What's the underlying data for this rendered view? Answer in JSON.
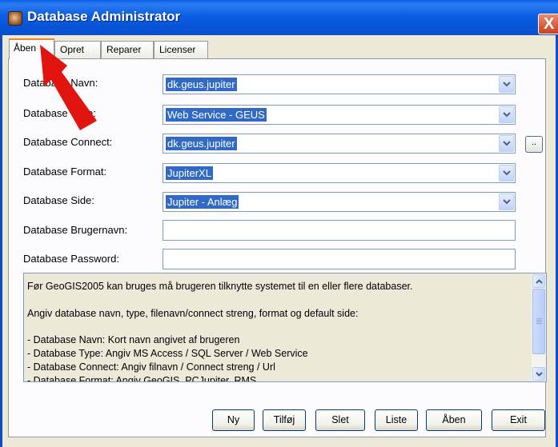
{
  "window": {
    "title": "Database Administrator",
    "close_label": "X"
  },
  "tabs": [
    {
      "label": "Åben"
    },
    {
      "label": "Opret"
    },
    {
      "label": "Reparer"
    },
    {
      "label": "Licenser"
    }
  ],
  "fields": {
    "name": {
      "label": "Database Navn:",
      "value": "dk.geus.jupiter"
    },
    "type": {
      "label": "Database Type:",
      "value": "Web Service - GEUS"
    },
    "connect": {
      "label": "Database Connect:",
      "value": "dk.geus.jupiter",
      "browse_label": ".."
    },
    "format": {
      "label": "Database Format:",
      "value": "JupiterXL"
    },
    "side": {
      "label": "Database Side:",
      "value": "Jupiter - Anlæg"
    },
    "username": {
      "label": "Database Brugernavn:",
      "value": ""
    },
    "password": {
      "label": "Database Password:",
      "value": ""
    }
  },
  "info": {
    "lines": [
      "Før GeoGIS2005 kan bruges må brugeren tilknytte systemet til en eller flere databaser.",
      "Angiv database navn, type, filenavn/connect streng, format og default side:",
      "- Database Navn: Kort navn angivet af brugeren",
      "- Database Type: Angiv MS Access / SQL Server / Web Service",
      "- Database Connect: Angiv filnavn / Connect streng / Url",
      "- Database Format: Angiv GeoGIS, PCJupiter, RMS ..."
    ]
  },
  "buttons": {
    "ny": "Ny",
    "tilfoj": "Tilføj",
    "slet": "Slet",
    "liste": "Liste",
    "aaben": "Åben",
    "exit": "Exit"
  },
  "colors": {
    "title_bar": "#0553d6",
    "selection": "#316ac5",
    "annotation_arrow": "#e2140f",
    "active_tab_accent": "#e68b2c"
  },
  "icons": {
    "app": "database-app-icon",
    "dropdown": "chevron-down-icon",
    "annotation": "red-arrow-pointer"
  }
}
